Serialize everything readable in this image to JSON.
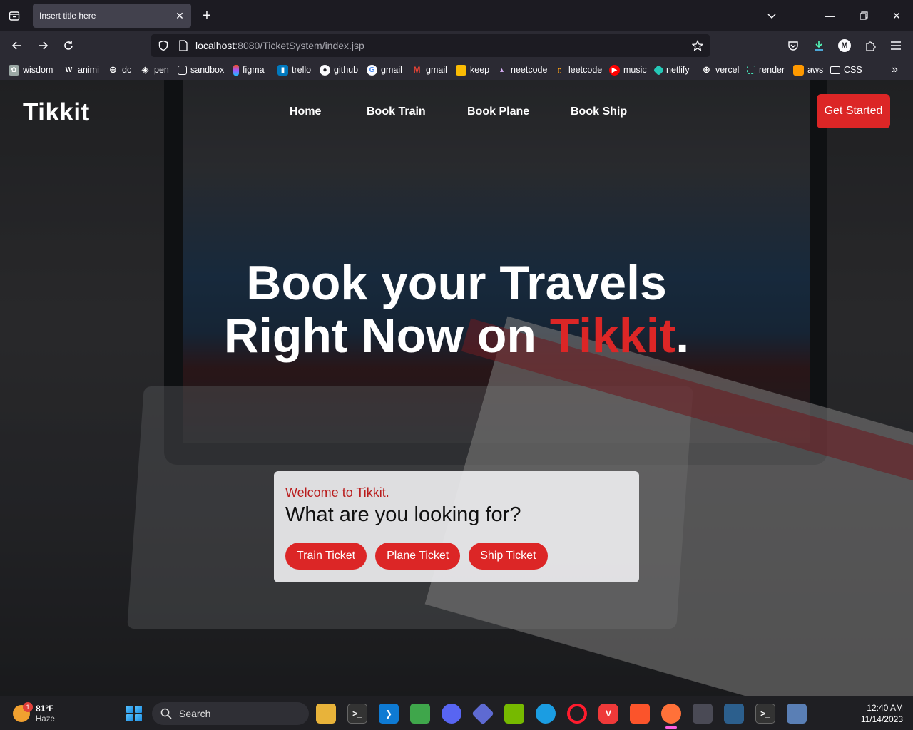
{
  "browser": {
    "tab_title": "Insert title here",
    "url_host": "localhost",
    "url_rest": ":8080/TicketSystem/index.jsp",
    "bookmarks": [
      {
        "label": "wisdom",
        "icon": "openai-icon",
        "color": "#9aa7a4"
      },
      {
        "label": "animi",
        "icon": "animi-icon",
        "color": "#6b6b6b"
      },
      {
        "label": "dc",
        "icon": "globe-icon",
        "color": "#444"
      },
      {
        "label": "pen",
        "icon": "codepen-icon",
        "color": "#222"
      },
      {
        "label": "sandbox",
        "icon": "sandbox-icon",
        "color": "#222"
      },
      {
        "label": "figma",
        "icon": "figma-icon",
        "color": "#a259ff"
      },
      {
        "label": "trello",
        "icon": "trello-icon",
        "color": "#0079bf"
      },
      {
        "label": "github",
        "icon": "github-icon",
        "color": "#333"
      },
      {
        "label": "gmail",
        "icon": "google-icon",
        "color": "#4285f4"
      },
      {
        "label": "gmail",
        "icon": "gmail-icon",
        "color": "#ea4335"
      },
      {
        "label": "keep",
        "icon": "keep-icon",
        "color": "#fbbc04"
      },
      {
        "label": "neetcode",
        "icon": "neetcode-icon",
        "color": "#d8b4fe"
      },
      {
        "label": "leetcode",
        "icon": "leetcode-icon",
        "color": "#ffa116"
      },
      {
        "label": "music",
        "icon": "youtube-music-icon",
        "color": "#ff0000"
      },
      {
        "label": "netlify",
        "icon": "netlify-icon",
        "color": "#25c7b7"
      },
      {
        "label": "vercel",
        "icon": "globe-icon",
        "color": "#444"
      },
      {
        "label": "render",
        "icon": "render-icon",
        "color": "#46e3b7"
      },
      {
        "label": "aws",
        "icon": "aws-icon",
        "color": "#ff9900"
      },
      {
        "label": "CSS",
        "icon": "folder-icon",
        "color": "#2b2a33"
      }
    ]
  },
  "site": {
    "logo": "Tikkit",
    "nav": [
      "Home",
      "Book Train",
      "Book Plane",
      "Book Ship"
    ],
    "cta": "Get Started",
    "hero_line1": "Book your Travels",
    "hero_line2_pre": "Right Now on ",
    "hero_accent": "Tikkit",
    "hero_period": ".",
    "accent_color": "#dc2626",
    "card": {
      "welcome": "Welcome to Tikkit.",
      "question": "What are you looking for?",
      "buttons": [
        "Train Ticket",
        "Plane Ticket",
        "Ship Ticket"
      ]
    }
  },
  "taskbar": {
    "weather_temp": "81°F",
    "weather_cond": "Haze",
    "weather_badge": "1",
    "search_placeholder": "Search",
    "apps": [
      {
        "name": "file-explorer-icon",
        "color": "#e8b33a"
      },
      {
        "name": "terminal-icon",
        "color": "#333"
      },
      {
        "name": "vscode-icon",
        "color": "#0e7ad3"
      },
      {
        "name": "green-app-icon",
        "color": "#3fa64b"
      },
      {
        "name": "discord-icon",
        "color": "#5865f2"
      },
      {
        "name": "linear-icon",
        "color": "#5e6ad2"
      },
      {
        "name": "nvidia-icon",
        "color": "#76b900"
      },
      {
        "name": "edge-icon",
        "color": "#1b9de2"
      },
      {
        "name": "opera-icon",
        "color": "#ff1b2d"
      },
      {
        "name": "vivaldi-icon",
        "color": "#ef3939"
      },
      {
        "name": "brave-icon",
        "color": "#fb542b"
      },
      {
        "name": "firefox-icon",
        "color": "#ff7139"
      },
      {
        "name": "app-store-icon",
        "color": "#4a4a55"
      },
      {
        "name": "mysql-workbench-icon",
        "color": "#2c5f8d"
      },
      {
        "name": "cmd-icon",
        "color": "#333"
      },
      {
        "name": "editor-icon",
        "color": "#5a7fb5"
      }
    ],
    "time": "12:40 AM",
    "date": "11/14/2023"
  }
}
